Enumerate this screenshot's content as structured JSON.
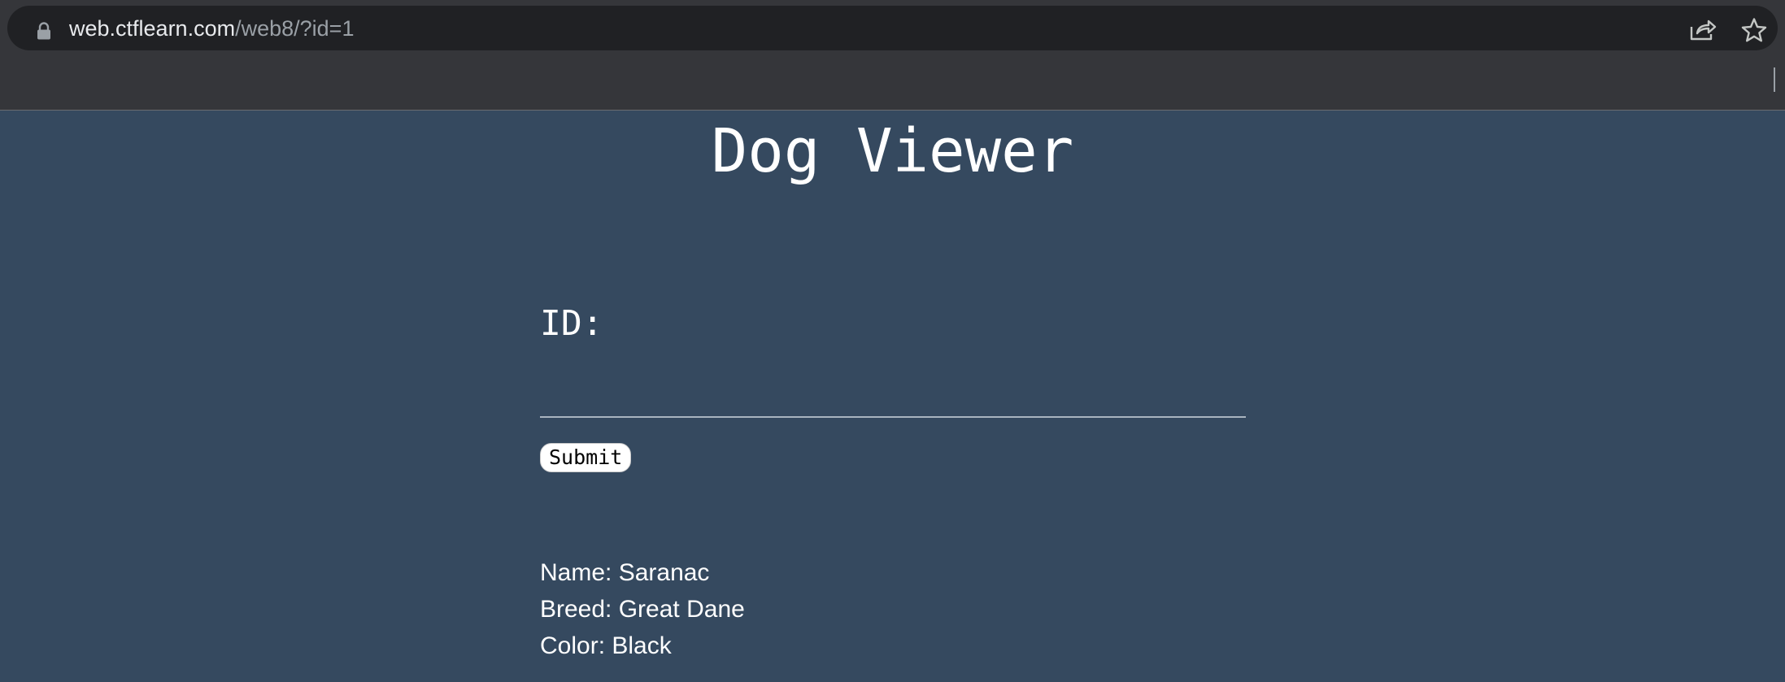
{
  "browser": {
    "url_host": "web.ctflearn.com",
    "url_path": "/web8/?id=1",
    "icons": {
      "lock": "lock-icon",
      "share": "share-icon",
      "bookmark": "star-icon"
    }
  },
  "page": {
    "title": "Dog Viewer",
    "id_label": "ID:",
    "id_input_value": "",
    "submit_label": "Submit",
    "result": {
      "name": "Name: Saranac",
      "breed": "Breed: Great Dane",
      "color": "Color: Black"
    }
  },
  "colors": {
    "page_background": "#35495f",
    "chrome_background": "#35363a",
    "omnibox_background": "#202124",
    "text": "#ffffff"
  }
}
